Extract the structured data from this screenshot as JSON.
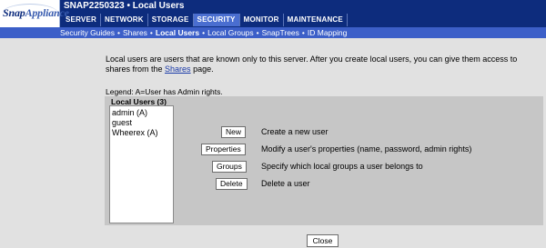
{
  "brand": {
    "snap": "Snap",
    "appliance": "Appliance"
  },
  "header": {
    "title": "SNAP2250323 • Local Users"
  },
  "main_nav": [
    {
      "label": "SERVER",
      "active": false
    },
    {
      "label": "NETWORK",
      "active": false
    },
    {
      "label": "STORAGE",
      "active": false
    },
    {
      "label": "SECURITY",
      "active": true
    },
    {
      "label": "MONITOR",
      "active": false
    },
    {
      "label": "MAINTENANCE",
      "active": false
    }
  ],
  "sub_nav": [
    {
      "label": "Security Guides",
      "active": false
    },
    {
      "label": "Shares",
      "active": false
    },
    {
      "label": "Local Users",
      "active": true
    },
    {
      "label": "Local Groups",
      "active": false
    },
    {
      "label": "SnapTrees",
      "active": false
    },
    {
      "label": "ID Mapping",
      "active": false
    }
  ],
  "intro": {
    "text_before": "Local users are users that are known only to this server. After you create local users, you can give them access to shares from the ",
    "link": "Shares",
    "text_after": " page."
  },
  "legend": "Legend: A=User has Admin rights.",
  "users": {
    "label": "Local Users (3)",
    "items": [
      "admin (A)",
      "guest",
      "Wheerex (A)"
    ]
  },
  "actions": [
    {
      "button": "New",
      "description": "Create a new user"
    },
    {
      "button": "Properties",
      "description": "Modify a user's properties (name, password, admin rights)"
    },
    {
      "button": "Groups",
      "description": "Specify which local groups a user belongs to"
    },
    {
      "button": "Delete",
      "description": "Delete a user"
    }
  ],
  "close_label": "Close",
  "colors": {
    "header": "#0d2c7d",
    "subnav": "#3c5fc8",
    "active_tab": "#4a6ed0",
    "panel": "#c6c6c6",
    "page": "#e1e1e1"
  }
}
